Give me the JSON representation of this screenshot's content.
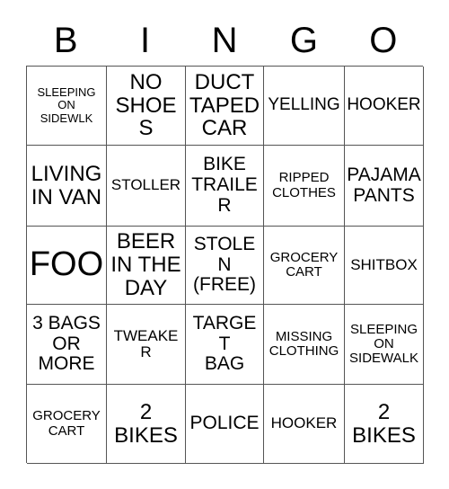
{
  "card": {
    "header": {
      "letters": [
        "B",
        "I",
        "N",
        "G",
        "O"
      ]
    },
    "grid": {
      "rows": [
        [
          {
            "text": "SLEEPING\nON\nSIDEWLK",
            "size": "fs-xs"
          },
          {
            "text": "NO\nSHOES",
            "size": "fs-xxl"
          },
          {
            "text": "DUCT\nTAPED\nCAR",
            "size": "fs-xxl"
          },
          {
            "text": "YELLING",
            "size": "fs-lg"
          },
          {
            "text": "HOOKER",
            "size": "fs-lg"
          }
        ],
        [
          {
            "text": "LIVING\nIN VAN",
            "size": "fs-xxl"
          },
          {
            "text": "STOLLER",
            "size": "fs-md"
          },
          {
            "text": "BIKE\nTRAILER",
            "size": "fs-xl"
          },
          {
            "text": "RIPPED\nCLOTHES",
            "size": "fs-sm"
          },
          {
            "text": "PAJAMA\nPANTS",
            "size": "fs-xl"
          }
        ],
        [
          {
            "text": "FOO",
            "size": "fs-huge"
          },
          {
            "text": "BEER\nIN THE\nDAY",
            "size": "fs-xxl"
          },
          {
            "text": "STOLEN\n(FREE)",
            "size": "fs-xl"
          },
          {
            "text": "GROCERY\nCART",
            "size": "fs-sm"
          },
          {
            "text": "SHITBOX",
            "size": "fs-md"
          }
        ],
        [
          {
            "text": "3 BAGS\nOR\nMORE",
            "size": "fs-xl"
          },
          {
            "text": "TWEAKER",
            "size": "fs-md"
          },
          {
            "text": "TARGET\nBAG",
            "size": "fs-xl"
          },
          {
            "text": "MISSING\nCLOTHING",
            "size": "fs-sm"
          },
          {
            "text": "SLEEPING\nON\nSIDEWALK",
            "size": "fs-sm"
          }
        ],
        [
          {
            "text": "GROCERY\nCART",
            "size": "fs-sm"
          },
          {
            "text": "2\nBIKES",
            "size": "fs-xxl"
          },
          {
            "text": "POLICE",
            "size": "fs-xl"
          },
          {
            "text": "HOOKER",
            "size": "fs-md"
          },
          {
            "text": "2\nBIKES",
            "size": "fs-xxl"
          }
        ]
      ]
    }
  }
}
